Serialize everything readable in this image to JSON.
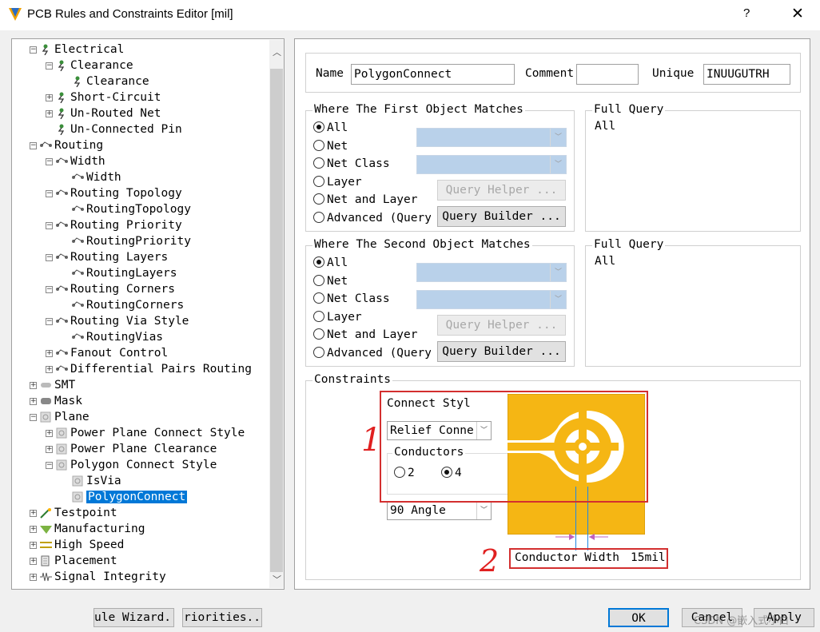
{
  "window": {
    "title": "PCB Rules and Constraints Editor [mil]",
    "help": "?",
    "close": "✕"
  },
  "tree": {
    "items": [
      {
        "label": "Electrical",
        "icon": "electrical-icon",
        "exp": "−"
      },
      {
        "label": "Clearance",
        "icon": "electrical-icon",
        "exp": "−"
      },
      {
        "label": "Clearance",
        "icon": "electrical-icon",
        "exp": ""
      },
      {
        "label": "Short-Circuit",
        "icon": "electrical-icon",
        "exp": "+"
      },
      {
        "label": "Un-Routed Net",
        "icon": "electrical-icon",
        "exp": "+"
      },
      {
        "label": "Un-Connected Pin",
        "icon": "electrical-icon",
        "exp": ""
      },
      {
        "label": "Routing",
        "icon": "routing-icon",
        "exp": "−"
      },
      {
        "label": "Width",
        "icon": "routing-icon",
        "exp": "−"
      },
      {
        "label": "Width",
        "icon": "routing-icon",
        "exp": ""
      },
      {
        "label": "Routing Topology",
        "icon": "routing-icon",
        "exp": "−"
      },
      {
        "label": "RoutingTopology",
        "icon": "routing-icon",
        "exp": ""
      },
      {
        "label": "Routing Priority",
        "icon": "routing-icon",
        "exp": "−"
      },
      {
        "label": "RoutingPriority",
        "icon": "routing-icon",
        "exp": ""
      },
      {
        "label": "Routing Layers",
        "icon": "routing-icon",
        "exp": "−"
      },
      {
        "label": "RoutingLayers",
        "icon": "routing-icon",
        "exp": ""
      },
      {
        "label": "Routing Corners",
        "icon": "routing-icon",
        "exp": "−"
      },
      {
        "label": "RoutingCorners",
        "icon": "routing-icon",
        "exp": ""
      },
      {
        "label": "Routing Via Style",
        "icon": "routing-icon",
        "exp": "−"
      },
      {
        "label": "RoutingVias",
        "icon": "routing-icon",
        "exp": ""
      },
      {
        "label": "Fanout Control",
        "icon": "routing-icon",
        "exp": "+"
      },
      {
        "label": "Differential Pairs Routing",
        "icon": "routing-icon",
        "exp": "+"
      },
      {
        "label": "SMT",
        "icon": "smt-icon",
        "exp": "+"
      },
      {
        "label": "Mask",
        "icon": "mask-icon",
        "exp": "+"
      },
      {
        "label": "Plane",
        "icon": "plane-icon",
        "exp": "−"
      },
      {
        "label": "Power Plane Connect Style",
        "icon": "plane-icon",
        "exp": "+"
      },
      {
        "label": "Power Plane Clearance",
        "icon": "plane-icon",
        "exp": "+"
      },
      {
        "label": "Polygon Connect Style",
        "icon": "plane-icon",
        "exp": "−"
      },
      {
        "label": "IsVia",
        "icon": "plane-icon",
        "exp": ""
      },
      {
        "label": "PolygonConnect",
        "icon": "plane-icon",
        "exp": "",
        "selected": true
      },
      {
        "label": "Testpoint",
        "icon": "testpoint-icon",
        "exp": "+"
      },
      {
        "label": "Manufacturing",
        "icon": "manufacturing-icon",
        "exp": "+"
      },
      {
        "label": "High Speed",
        "icon": "high-speed-icon",
        "exp": "+"
      },
      {
        "label": "Placement",
        "icon": "placement-icon",
        "exp": "+"
      },
      {
        "label": "Signal Integrity",
        "icon": "signal-integrity-icon",
        "exp": "+"
      }
    ]
  },
  "rule": {
    "name_label": "Name",
    "name_value": "PolygonConnect",
    "comment_label": "Comment",
    "comment_value": "",
    "unique_label": "Unique",
    "unique_value": "INUUGUTRH"
  },
  "first": {
    "legend": "Where The First Object Matches",
    "options": [
      "All",
      "Net",
      "Net Class",
      "Layer",
      "Net and Layer",
      "Advanced (Query)"
    ],
    "query_helper": "Query Helper ...",
    "query_builder": "Query Builder ...",
    "full_query_legend": "Full Query",
    "full_query_value": "All"
  },
  "second": {
    "legend": "Where The Second Object Matches",
    "options": [
      "All",
      "Net",
      "Net Class",
      "Layer",
      "Net and Layer",
      "Advanced (Query)"
    ],
    "query_helper": "Query Helper ...",
    "query_builder": "Query Builder ...",
    "full_query_legend": "Full Query",
    "full_query_value": "All"
  },
  "constraints": {
    "legend": "Constraints",
    "connect_style_label": "Connect Styl",
    "connect_style_value": "Relief Conne",
    "conductors_legend": "Conductors",
    "conductors_options": [
      "2",
      "4"
    ],
    "conductors_selected": "4",
    "angle_value": "90 Angle",
    "conductor_width_label": "Conductor Width",
    "conductor_width_value": "15mil"
  },
  "annotations": {
    "mark1": "1",
    "mark2": "2"
  },
  "footer": {
    "rule_wizard": "ule Wizard..",
    "priorities": "riorities..",
    "ok": "OK",
    "cancel": "Cancel",
    "apply": "Apply",
    "watermark": "CSDN @嵌入式小白"
  },
  "colors": {
    "selection": "#0078d7",
    "pad": "#f5b614",
    "annotation": "#d32f2f",
    "query_combo": "#b9d1ea"
  }
}
